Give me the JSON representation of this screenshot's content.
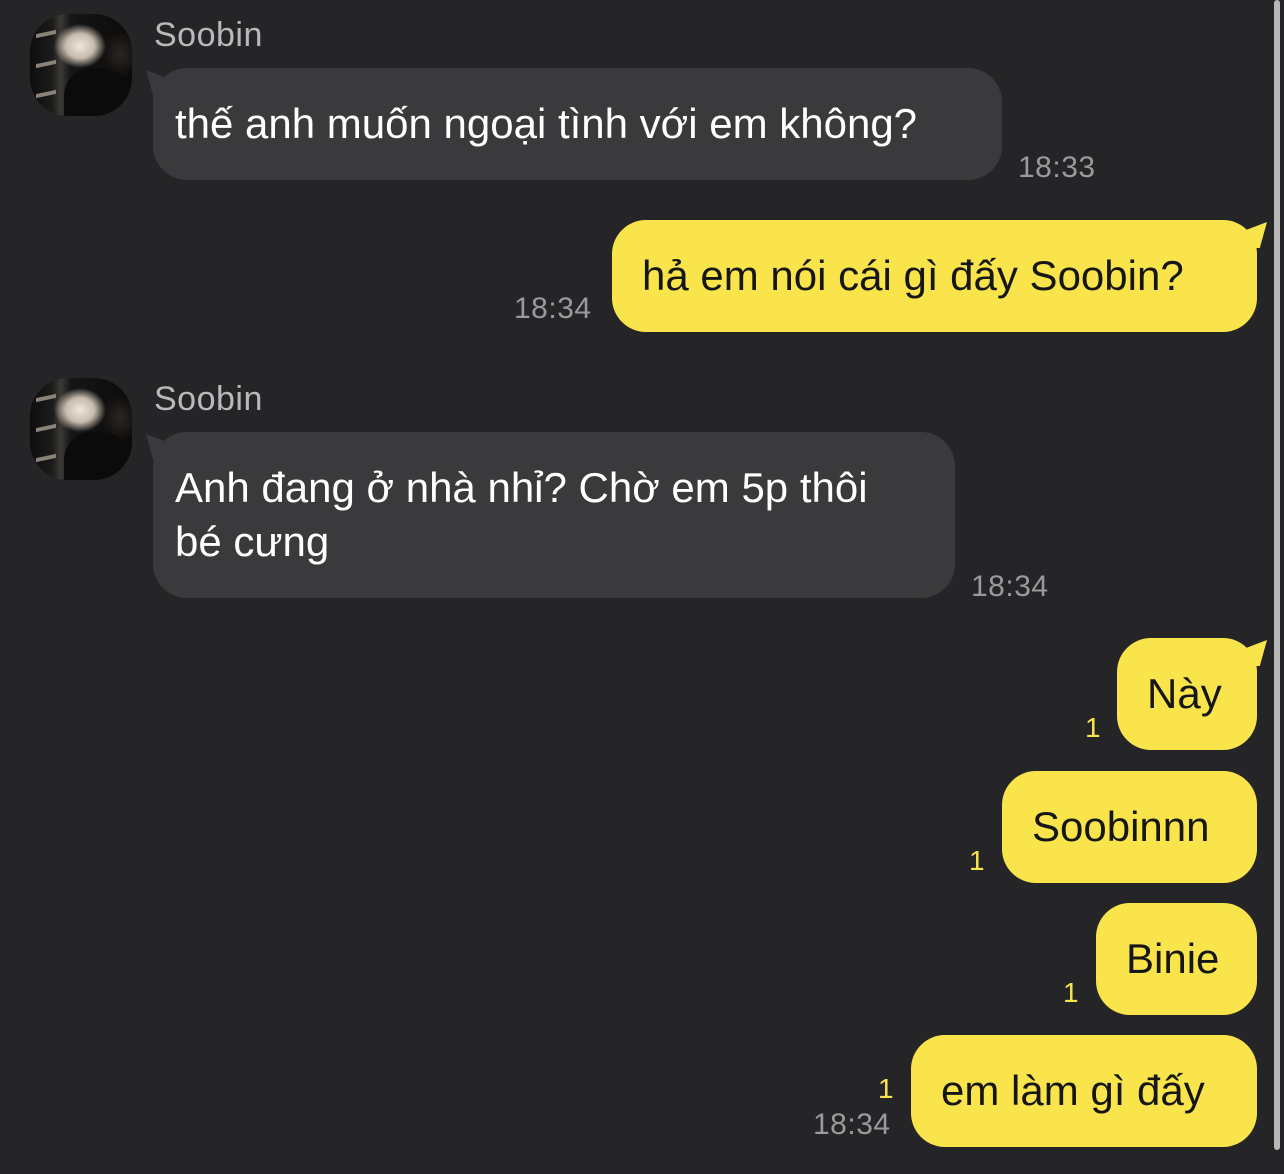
{
  "messages": [
    {
      "sender": "Soobin",
      "text": "thế anh muốn ngoại tình với em không?",
      "time": "18:33"
    },
    {
      "text": "hả em nói cái gì đấy Soobin?",
      "time": "18:34"
    },
    {
      "sender": "Soobin",
      "lines": [
        "Anh đang ở nhà nhỉ? Chờ em 5p thôi",
        "bé cưng"
      ],
      "time": "18:34"
    },
    {
      "text": "Này",
      "unread": "1"
    },
    {
      "text": "Soobinnn",
      "unread": "1"
    },
    {
      "text": "Binie",
      "unread": "1"
    },
    {
      "text": "em làm gì đấy",
      "unread": "1",
      "time": "18:34"
    }
  ],
  "colors": {
    "background": "#252527",
    "incoming_bubble": "#3a3a3c",
    "outgoing_bubble": "#f9e54b",
    "unread_count": "#f9e54b"
  },
  "icons": [
    "avatar-photo"
  ]
}
